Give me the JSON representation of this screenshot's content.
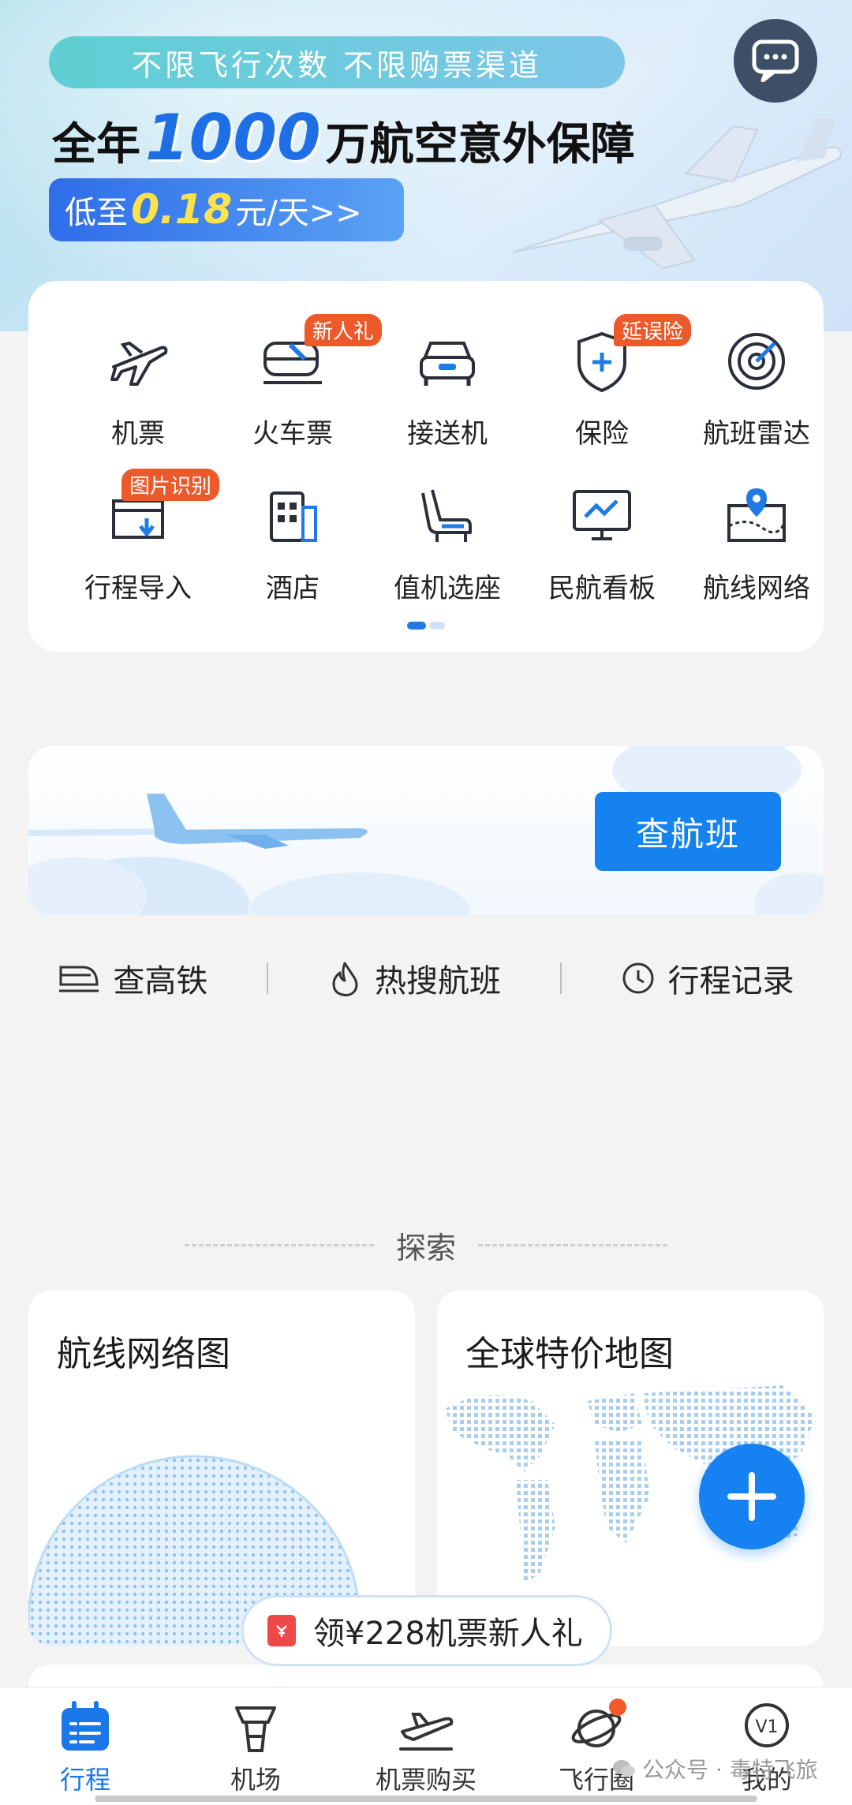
{
  "banner": {
    "slogan": "不限飞行次数 不限购票渠道",
    "headline_pre": "全年",
    "headline_amount": "1000",
    "headline_post": "万航空意外保障",
    "price_pre": "低至",
    "price_value": "0.18",
    "price_post": "元/天>>",
    "chat_icon": "chat-bubble-icon"
  },
  "services": {
    "items": [
      {
        "label": "机票",
        "icon": "airplane-icon",
        "badge": ""
      },
      {
        "label": "火车票",
        "icon": "train-icon",
        "badge": "新人礼"
      },
      {
        "label": "接送机",
        "icon": "car-icon",
        "badge": ""
      },
      {
        "label": "保险",
        "icon": "shield-plus-icon",
        "badge": "延误险"
      },
      {
        "label": "航班雷达",
        "icon": "radar-icon",
        "badge": ""
      },
      {
        "label": "行程导入",
        "icon": "import-calendar-icon",
        "badge": "图片识别"
      },
      {
        "label": "酒店",
        "icon": "hotel-icon",
        "badge": ""
      },
      {
        "label": "值机选座",
        "icon": "seat-icon",
        "badge": ""
      },
      {
        "label": "民航看板",
        "icon": "monitor-chart-icon",
        "badge": ""
      },
      {
        "label": "航线网络",
        "icon": "map-pin-icon",
        "badge": ""
      }
    ],
    "page": 1,
    "pages": 2
  },
  "flight_search": {
    "button_label": "查航班"
  },
  "quick_links": [
    {
      "label": "查高铁",
      "icon": "high-speed-train-icon"
    },
    {
      "label": "热搜航班",
      "icon": "flame-icon"
    },
    {
      "label": "行程记录",
      "icon": "clock-icon"
    }
  ],
  "explore": {
    "title": "探索",
    "cards": [
      {
        "title": "航线网络图"
      },
      {
        "title": "全球特价地图"
      }
    ]
  },
  "promo": {
    "text": "领¥228机票新人礼"
  },
  "tabbar": {
    "tabs": [
      {
        "label": "行程",
        "icon": "itinerary-icon",
        "active": true
      },
      {
        "label": "机场",
        "icon": "control-tower-icon",
        "active": false
      },
      {
        "label": "机票购买",
        "icon": "plane-takeoff-icon",
        "active": false
      },
      {
        "label": "飞行圈",
        "icon": "planet-icon",
        "active": false
      },
      {
        "label": "我的",
        "icon": "profile-v1-icon",
        "active": false
      }
    ],
    "profile_badge": "V1"
  },
  "watermark": "公众号 · 毒特飞旅",
  "colors": {
    "accent": "#1582f0",
    "badge": "#ec5a2c",
    "active_tab": "#1b76e8"
  }
}
